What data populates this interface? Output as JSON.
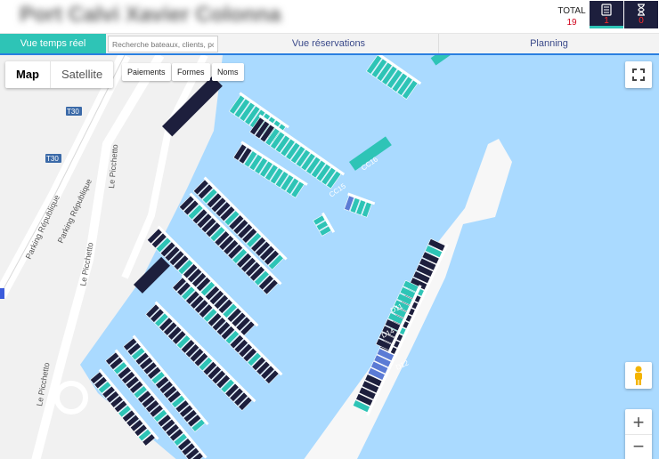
{
  "header": {
    "port_name": "Port Calvi Xavier Colonna",
    "total_label": "TOTAL",
    "total_value": "19",
    "list_count": "1",
    "hourglass_count": "0"
  },
  "tabs": {
    "realtime": "Vue temps réel",
    "search_placeholder": "Recherche bateaux, clients, pos",
    "reservations": "Vue réservations",
    "planning": "Planning"
  },
  "map": {
    "map_label": "Map",
    "satellite_label": "Satellite",
    "payments_label": "Paiements",
    "shapes_label": "Formes",
    "names_label": "Noms",
    "zoom_in": "+",
    "zoom_out": "−",
    "road_labels": [
      "T30",
      "T30",
      "Parking République",
      "Parking République",
      "Le Picchetto",
      "Le Picchetto",
      "Le Picchetto"
    ],
    "pontoon_labels": [
      "CC15",
      "CC16",
      "D11",
      "D14",
      "D12"
    ]
  },
  "colors": {
    "accent": "#2ec4b6",
    "water": "#aadaff",
    "occupied": "#1d1f3d",
    "reserved": "#5b7bd5",
    "alert": "#d0021b"
  }
}
